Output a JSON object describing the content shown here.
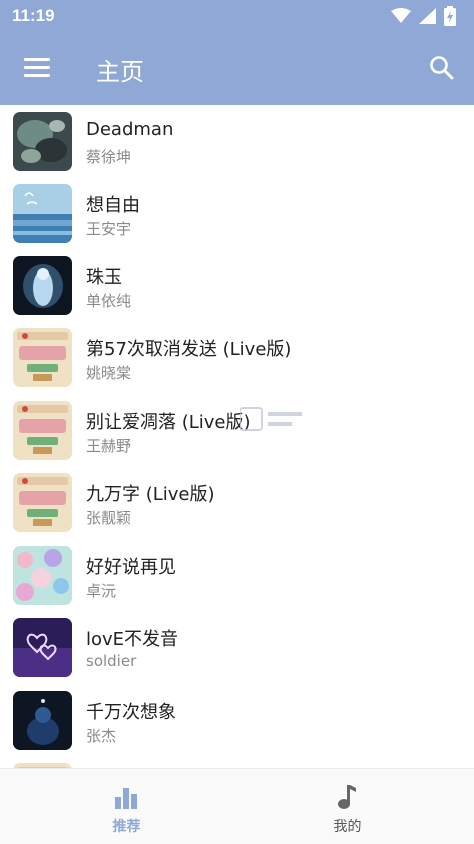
{
  "status_bar": {
    "time": "11:19",
    "icons": [
      "wifi-icon",
      "signal-icon",
      "battery-charging-icon"
    ]
  },
  "header": {
    "title": "主页",
    "menu_icon": "hamburger-menu-icon",
    "search_icon": "search-icon",
    "color": "#8fa8d6"
  },
  "songs": [
    {
      "title": "Deadman",
      "artist": "蔡徐坤"
    },
    {
      "title": "想自由",
      "artist": "王安宇"
    },
    {
      "title": "珠玉",
      "artist": "单依纯"
    },
    {
      "title": "第57次取消发送 (Live版)",
      "artist": "姚晓棠"
    },
    {
      "title": "别让爱凋落 (Live版)",
      "artist": "王赫野"
    },
    {
      "title": "九万字 (Live版)",
      "artist": "张靓颖"
    },
    {
      "title": "好好说再见",
      "artist": "卓沅"
    },
    {
      "title": "lovE不发音",
      "artist": "soldier"
    },
    {
      "title": "千万次想象",
      "artist": "张杰"
    }
  ],
  "bottom_nav": {
    "recommend_label": "推荐",
    "mine_label": "我的",
    "active_color": "#8fa8d6"
  }
}
